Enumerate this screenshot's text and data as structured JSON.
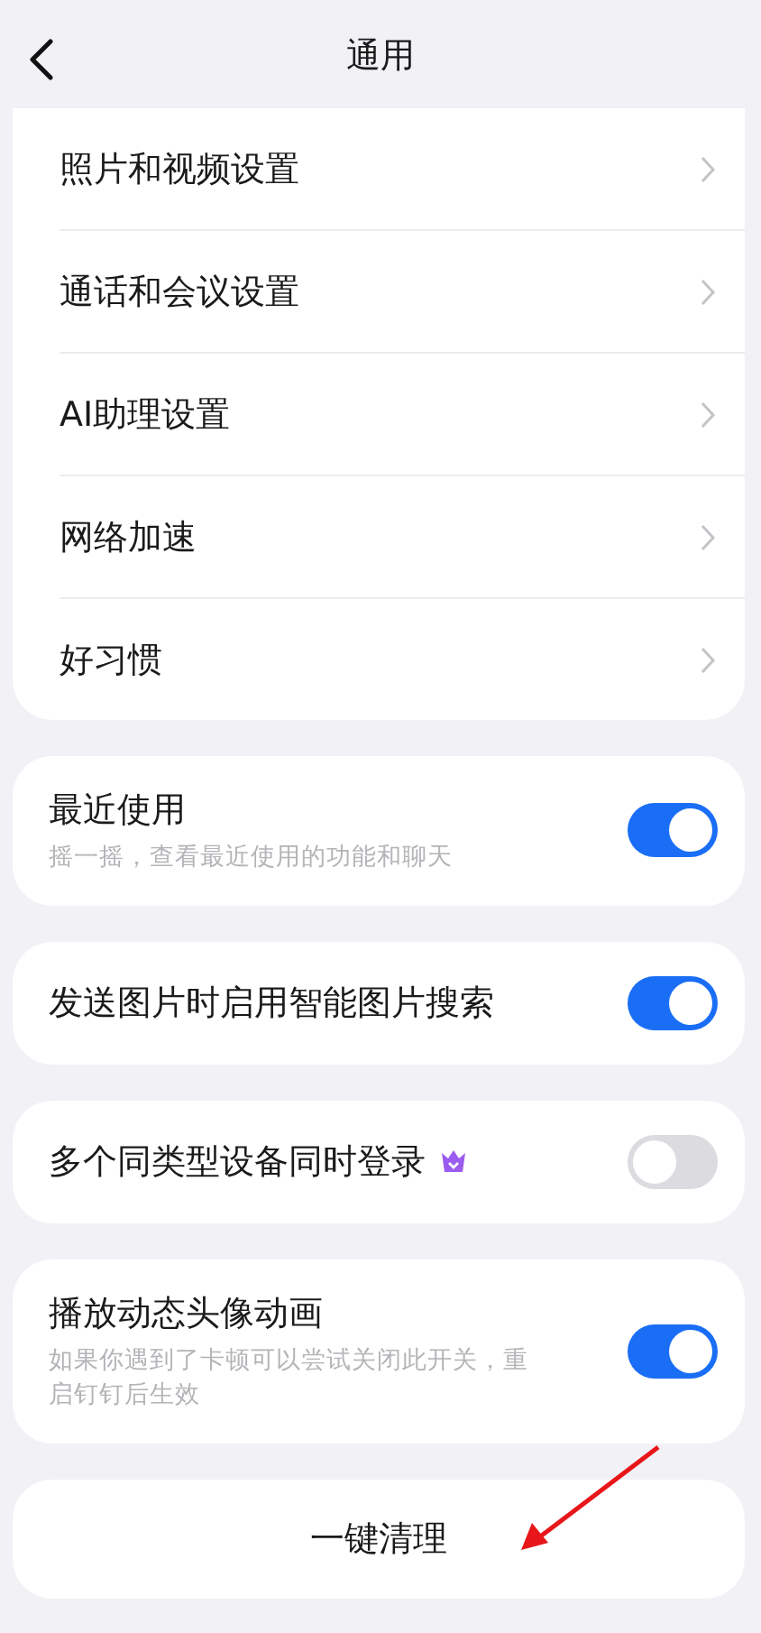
{
  "header": {
    "title": "通用"
  },
  "nav_group": {
    "items": [
      {
        "label": "照片和视频设置"
      },
      {
        "label": "通话和会议设置"
      },
      {
        "label": "AI助理设置"
      },
      {
        "label": "网络加速"
      },
      {
        "label": "好习惯"
      }
    ]
  },
  "toggle_cards": [
    {
      "label": "最近使用",
      "description": "摇一摇，查看最近使用的功能和聊天",
      "on": true,
      "premium": false
    },
    {
      "label": "发送图片时启用智能图片搜索",
      "on": true,
      "premium": false
    },
    {
      "label": "多个同类型设备同时登录",
      "on": false,
      "premium": true
    },
    {
      "label": "播放动态头像动画",
      "description": "如果你遇到了卡顿可以尝试关闭此开关，重启钉钉后生效",
      "on": true,
      "premium": false
    }
  ],
  "action_button": {
    "label": "一键清理"
  },
  "annotations": [
    {
      "kind": "arrow"
    }
  ]
}
